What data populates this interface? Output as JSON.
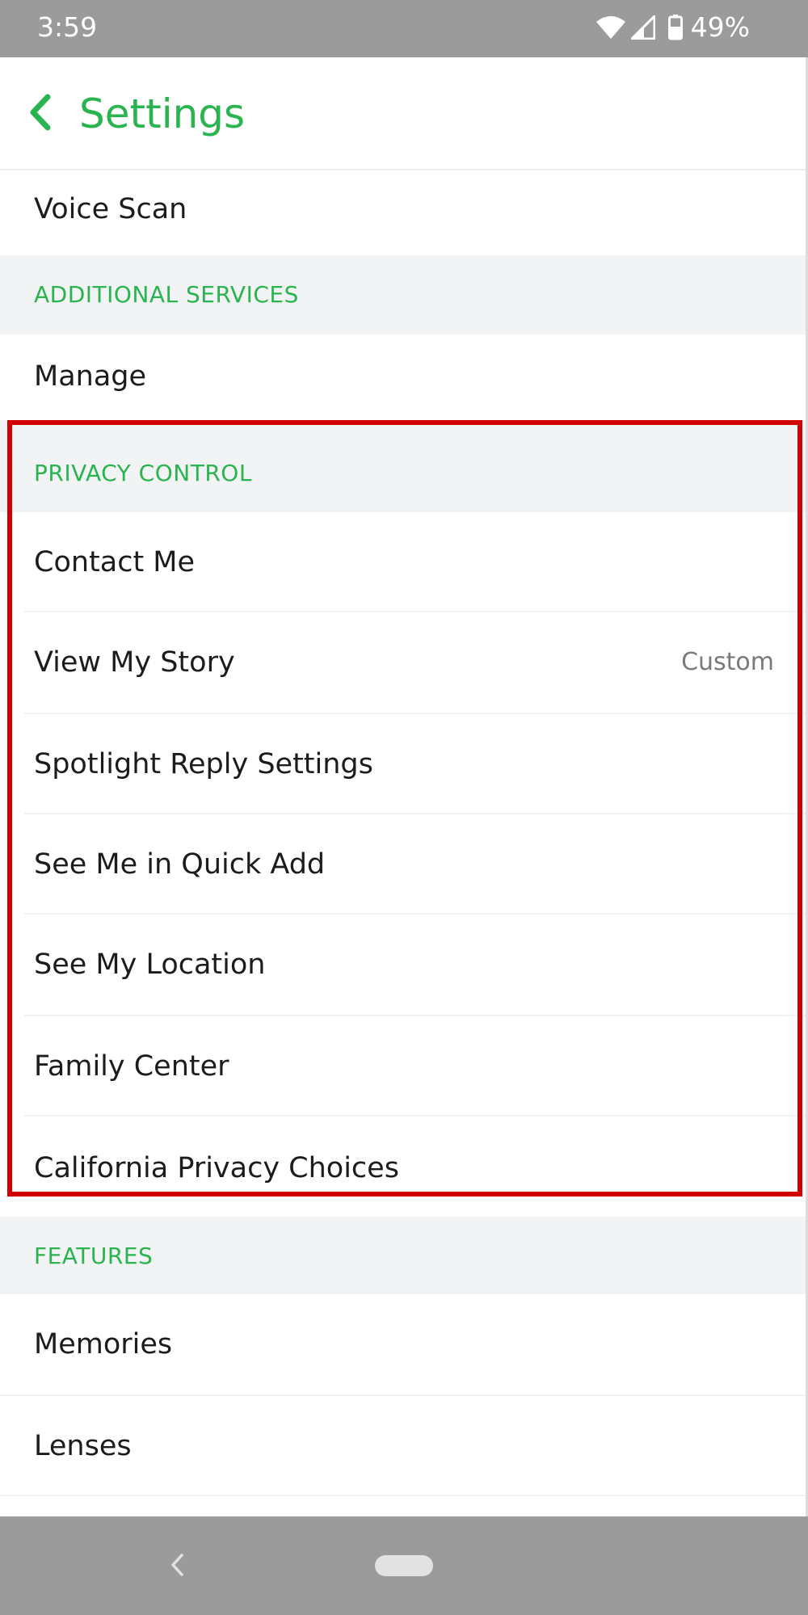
{
  "status_bar": {
    "time": "3:59",
    "battery_percent": "49%",
    "icons": [
      "wifi-icon",
      "signal-icon",
      "battery-icon"
    ]
  },
  "header": {
    "title": "Settings",
    "back_icon": "chevron-left-icon"
  },
  "rows": {
    "voice_scan": "Voice Scan",
    "manage": "Manage",
    "contact_me": "Contact Me",
    "view_my_story": "View My Story",
    "view_my_story_value": "Custom",
    "spotlight_reply": "Spotlight Reply Settings",
    "quick_add": "See Me in Quick Add",
    "see_my_location": "See My Location",
    "family_center": "Family Center",
    "california_privacy": "California Privacy Choices",
    "memories": "Memories",
    "lenses": "Lenses"
  },
  "sections": {
    "additional_services": "ADDITIONAL SERVICES",
    "privacy_control": "PRIVACY CONTROL",
    "features": "FEATURES"
  },
  "colors": {
    "accent_green": "#2ab44f",
    "highlight_red": "#d10000",
    "system_bar_gray": "#9b9b9b",
    "section_bg": "#f2f3f4"
  },
  "nav_bar": {
    "icons": [
      "back-triangle-icon",
      "home-pill-icon"
    ]
  }
}
